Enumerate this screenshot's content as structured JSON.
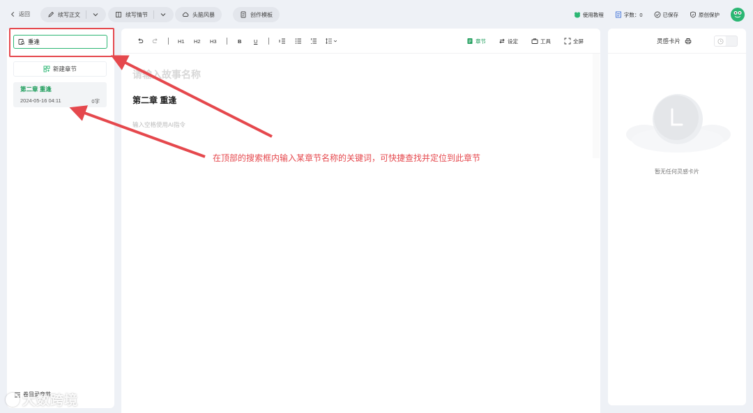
{
  "topbar": {
    "back_label": "返回",
    "continue_text_label": "续写正文",
    "continue_plot_label": "续写情节",
    "brainstorm_label": "头脑风暴",
    "template_label": "创作模板",
    "tutorial_label": "使用教程",
    "word_count_label": "字数：0",
    "saved_label": "已保存",
    "original_protection_label": "原创保护"
  },
  "sidebar": {
    "search_value": "重逢",
    "new_chapter_label": "新建章节",
    "chapters": [
      {
        "title": "第二章 重逢",
        "date": "2024-05-16 04:11",
        "count": "0字"
      }
    ],
    "bottom_label": "卷目录章节"
  },
  "editor": {
    "toolbar": {
      "h1": "H1",
      "h2": "H2",
      "h3": "H3",
      "bold": "B",
      "underline": "U",
      "chapter_label": "章节",
      "settings_label": "设定",
      "tools_label": "工具",
      "fullscreen_label": "全屏"
    },
    "story_title_placeholder": "请输入故事名称",
    "chapter_heading": "第二章 重逢",
    "ai_hint": "输入空格使用AI指令"
  },
  "inspiration": {
    "title": "灵感卡片",
    "empty_text": "暂无任何灵感卡片"
  },
  "annotation": {
    "text": "在顶部的搜索框内输入某章节名称的关键词，可快捷查找并定位到此章节",
    "color": "#e5484d"
  },
  "watermark": {
    "text": "大数跨境"
  },
  "colors": {
    "accent": "#2bb673",
    "chapter_green": "#1f9e5c",
    "page_bg": "#eef1f6"
  }
}
